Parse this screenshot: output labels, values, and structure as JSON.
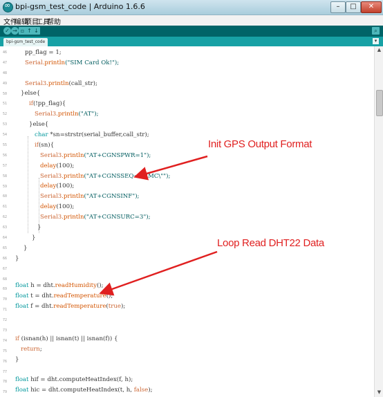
{
  "window": {
    "title": "bpi-gsm_test_code | Arduino 1.6.6",
    "min": "–",
    "max": "□",
    "close": "✕"
  },
  "menu": [
    "文件",
    "编辑",
    "项目",
    "工具",
    "帮助"
  ],
  "toolbar": {
    "verify": "✓",
    "upload": "→",
    "new": "▫",
    "open": "↑",
    "save": "↓",
    "serial": "⌕"
  },
  "tab": {
    "label": "bpi-gsm_test_code",
    "menu": "▾"
  },
  "scrollbar": {
    "up": "▲",
    "down": "▼"
  },
  "line_numbers": [
    "46",
    "47",
    "48",
    "49",
    "50",
    "51",
    "52",
    "53",
    "54",
    "55",
    "56",
    "57",
    "58",
    "59",
    "60",
    "61",
    "62",
    "63",
    "64",
    "65",
    "66",
    "67",
    "68",
    "69",
    "70",
    "71",
    "72",
    "73",
    "74",
    "75",
    "76",
    "77",
    "78",
    "79"
  ],
  "code": {
    "l46": "pp_flag = 1;",
    "l47_obj": "Serial",
    "l47_fn": ".println",
    "l47_str": "(\"SIM Card Ok!\");",
    "l49_obj": "Serial3",
    "l49_fn": ".println",
    "l49_rest": "(call_str);",
    "l50": "}else{",
    "l51_kw": "if",
    "l51_rest": "(!pp_flag){",
    "l52_obj": "Serial3",
    "l52_fn": ".println",
    "l52_str": "(\"AT\");",
    "l53": "}else{",
    "l54_ty": "char",
    "l54_rest": " *sn=strstr(serial_buffer,call_str);",
    "l55_kw": "if",
    "l55_rest": "(sn){",
    "l56_obj": "Serial3",
    "l56_fn": ".println",
    "l56_str": "(\"AT+CGNSPWR=1\");",
    "l57_fn": "delay",
    "l57_rest": "(100);",
    "l58_obj": "Serial3",
    "l58_fn": ".println",
    "l58_str": "(\"AT+CGNSSEQ=\\\"RMC\\\"\");",
    "l59_fn": "delay",
    "l59_rest": "(100);",
    "l60_obj": "Serial3",
    "l60_fn": ".println",
    "l60_str": "(\"AT+CGNSINF\");",
    "l61_fn": "delay",
    "l61_rest": "(100);",
    "l62_obj": "Serial3",
    "l62_fn": ".println",
    "l62_str": "(\"AT+CGNSURC=3\");",
    "l63": "}",
    "l64": "}",
    "l65": "}",
    "l66": "}",
    "l69_ty": "float",
    "l69_rest": " h = dht.",
    "l69_fn": "readHumidity",
    "l69_end": "();",
    "l70_ty": "float",
    "l70_rest": " t = dht.",
    "l70_fn": "readTemperature",
    "l70_end": "();",
    "l71_ty": "float",
    "l71_rest": " f = dht.",
    "l71_fn": "readTemperature",
    "l71_mid": "(",
    "l71_kw": "true",
    "l71_end": ");",
    "l73_kw": "if",
    "l73_rest": " (isnan(h) || isnan(t) || isnan(f)) {",
    "l74_kw": "return",
    "l74_rest": ";",
    "l75": "}",
    "l77_ty": "float",
    "l77_rest": " hif = dht.computeHeatIndex(f, h);",
    "l78_ty": "float",
    "l78_rest": " hic = dht.computeHeatIndex(t, h, ",
    "l78_kw": "false",
    "l78_end": ");"
  },
  "annotations": {
    "gps": "Init GPS Output Format",
    "dht": "Loop Read DHT22 Data"
  },
  "colors": {
    "toolbar": "#006468",
    "tabrow": "#17a1a5",
    "annotation": "#e02020"
  }
}
